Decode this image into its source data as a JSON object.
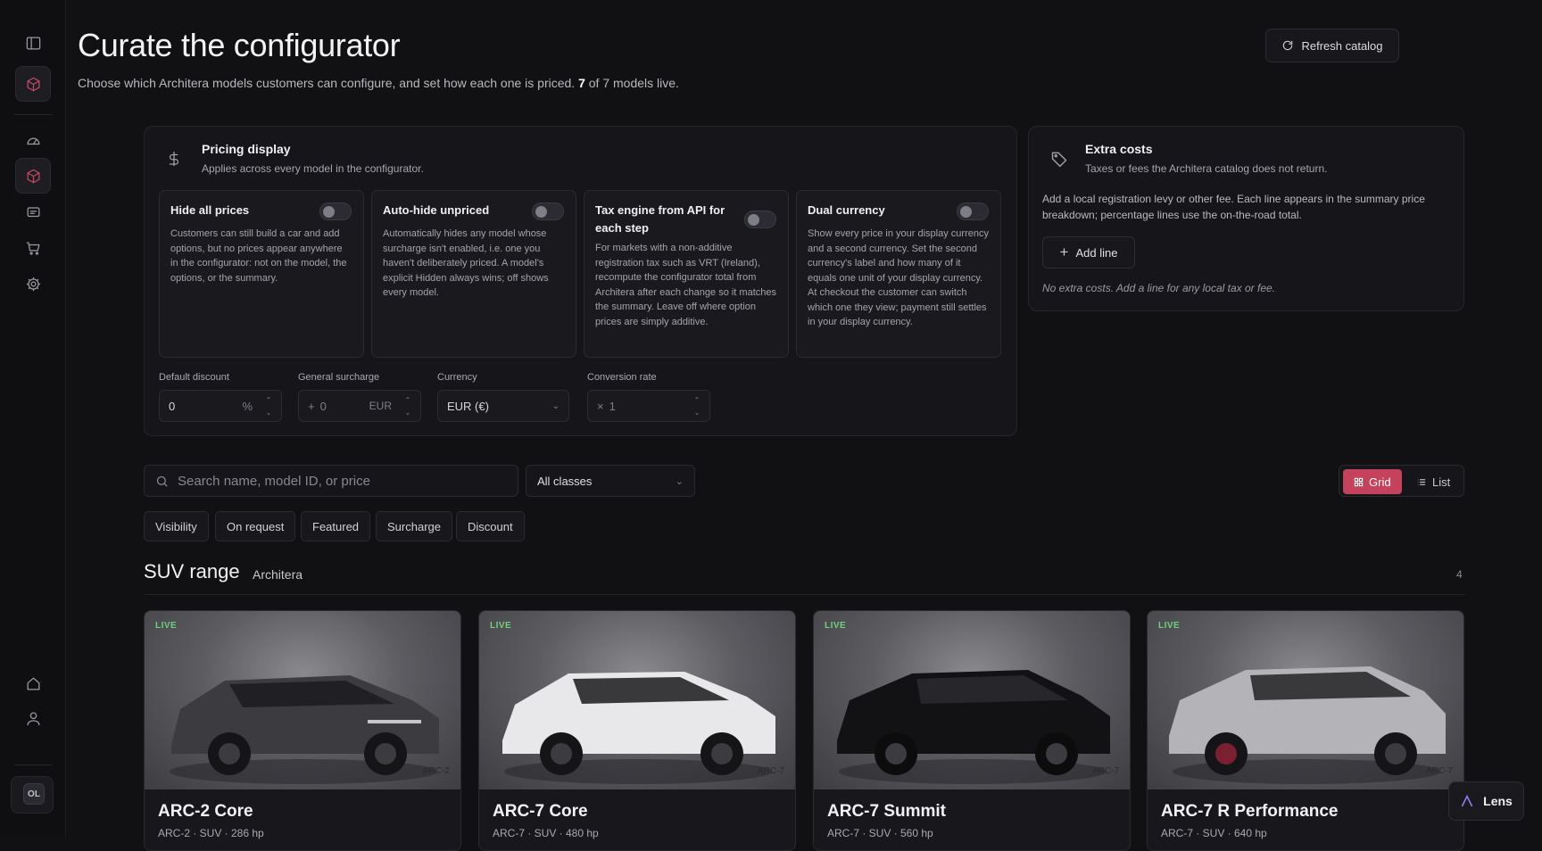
{
  "sidebar": {
    "items": [
      {
        "icon": "panel-toggle-icon"
      },
      {
        "icon": "cube-icon",
        "active": true
      },
      {
        "icon": "gauge-icon"
      },
      {
        "icon": "box-icon",
        "active": true
      },
      {
        "icon": "message-icon"
      },
      {
        "icon": "cart-icon"
      },
      {
        "icon": "gear-icon"
      },
      {
        "icon": "home-icon"
      },
      {
        "icon": "user-icon"
      }
    ],
    "avatar_initials": "OL"
  },
  "header": {
    "title": "Curate the configurator",
    "subtitle_pre": "Choose which Architera models customers can configure, and set how each one is priced.",
    "subtitle_live_count": "7",
    "subtitle_post": "of 7 models live.",
    "refresh_label": "Refresh catalog"
  },
  "pricing": {
    "title": "Pricing display",
    "desc": "Applies across every model in the configurator.",
    "options": [
      {
        "title": "Hide all prices",
        "desc": "Customers can still build a car and add options, but no prices appear anywhere in the configurator: not on the model, the options, or the summary.",
        "enabled": false
      },
      {
        "title": "Auto-hide unpriced",
        "desc": "Automatically hides any model whose surcharge isn't enabled, i.e. one you haven't deliberately priced. A model's explicit Hidden always wins; off shows every model.",
        "enabled": false
      },
      {
        "title": "Tax engine from API for each step",
        "desc": "For markets with a non-additive registration tax such as VRT (Ireland), recompute the configurator total from Architera after each change so it matches the summary. Leave off where option prices are simply additive.",
        "enabled": false
      },
      {
        "title": "Dual currency",
        "desc": "Show every price in your display currency and a second currency. Set the second currency's label and how many of it equals one unit of your display currency. At checkout the customer can switch which one they view; payment still settles in your display currency.",
        "enabled": false
      }
    ],
    "fields": {
      "discount_label": "Default discount",
      "discount_value": "0",
      "discount_unit": "%",
      "surcharge_label": "General surcharge",
      "surcharge_prefix": "+",
      "surcharge_value": "0",
      "surcharge_unit": "EUR",
      "currency_label": "Currency",
      "currency_value": "EUR (€)",
      "rate_label": "Conversion rate",
      "rate_prefix": "×",
      "rate_value": "1"
    }
  },
  "extra_costs": {
    "title": "Extra costs",
    "desc": "Taxes or fees the Architera catalog does not return.",
    "body": "Add a local registration levy or other fee. Each line appears in the summary price breakdown; percentage lines use the on-the-road total.",
    "add_label": "Add line",
    "empty": "No extra costs. Add a line for any local tax or fee."
  },
  "filters": {
    "search_placeholder": "Search name, model ID, or price",
    "class_select": "All classes",
    "chips": [
      "Visibility",
      "On request",
      "Featured",
      "Surcharge",
      "Discount"
    ],
    "view_grid": "Grid",
    "view_list": "List"
  },
  "section": {
    "title": "SUV range",
    "brand": "Architera",
    "count": "4"
  },
  "cards": [
    {
      "status": "LIVE",
      "name": "ARC-2 Core",
      "meta": "ARC-2 · SUV · 286 hp",
      "tag": "ARC-2",
      "car_color": "#3b3b40"
    },
    {
      "status": "LIVE",
      "name": "ARC-7 Core",
      "meta": "ARC-7 · SUV · 480 hp",
      "tag": "ARC-7",
      "car_color": "#e8e8ea"
    },
    {
      "status": "LIVE",
      "name": "ARC-7 Summit",
      "meta": "ARC-7 · SUV · 560 hp",
      "tag": "ARC-7",
      "car_color": "#121214"
    },
    {
      "status": "LIVE",
      "name": "ARC-7 R Performance",
      "meta": "ARC-7 · SUV · 640 hp",
      "tag": "ARC-7",
      "car_color": "#b4b4b8"
    }
  ],
  "lens": {
    "label": "Lens"
  },
  "colors": {
    "accent": "#c4425c",
    "live": "#6fcf7c",
    "background": "#111113"
  }
}
